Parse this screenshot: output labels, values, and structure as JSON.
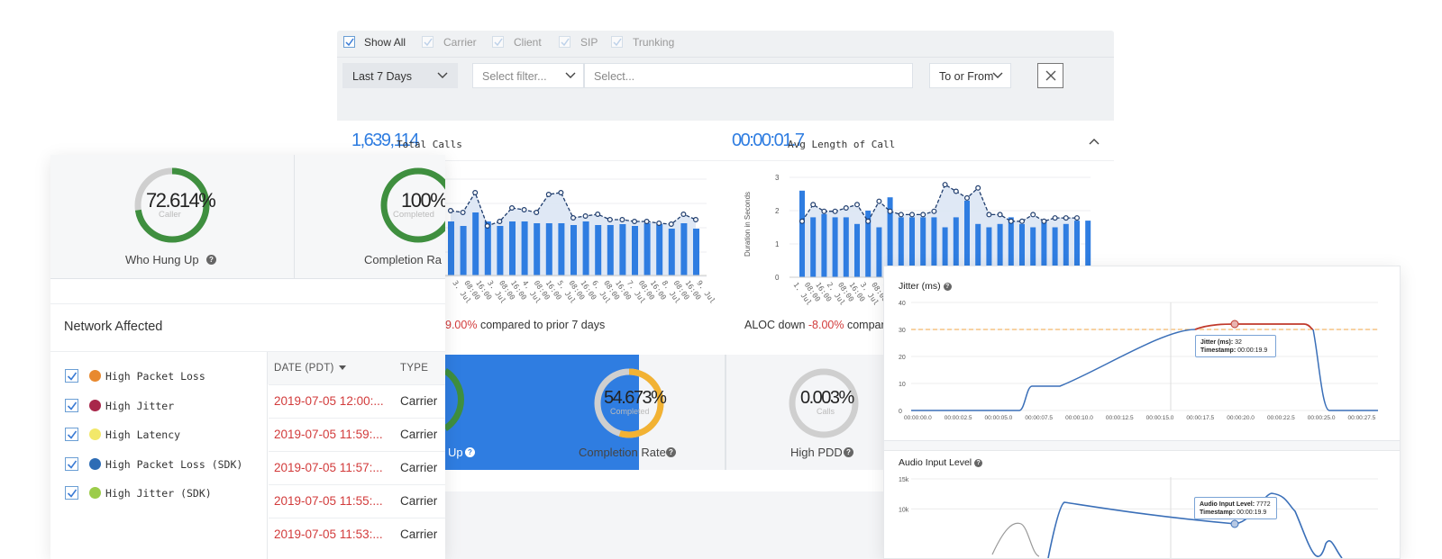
{
  "filters": {
    "show_all": "Show All",
    "carrier": "Carrier",
    "client": "Client",
    "sip": "SIP",
    "trunking": "Trunking"
  },
  "toolbar": {
    "date_range": "Last 7 Days",
    "filter_select_placeholder": "Select filter...",
    "filter_value_placeholder": "Select...",
    "direction": "To or From"
  },
  "summary": {
    "total_calls_value": "1,639,114",
    "total_calls_label": "Total Calls",
    "avg_length_value": "00:00:01.7",
    "avg_length_label": "Avg Length of Call",
    "calls_change_pct": "9.00%",
    "calls_change_text": "compared to prior 7 days",
    "aloc_prefix": "ALOC down",
    "aloc_change_pct": "-8.00%",
    "aloc_change_text": "compare"
  },
  "calls_chart": {
    "x_labels": [
      "3.\nJul",
      "08:00",
      "16:00",
      "3.\nJul",
      "08:00",
      "16:00",
      "4.\nJul",
      "08:00",
      "16:00",
      "5.\nJul",
      "08:00",
      "16:00",
      "6.\nJul",
      "08:00",
      "16:00",
      "7.\nJul",
      "08:00",
      "16:00",
      "8.\nJul",
      "08:00",
      "16:00",
      "9.\nJul"
    ]
  },
  "aloc_chart": {
    "ylabel": "Duration in Seconds",
    "y_ticks": [
      "3",
      "2",
      "1",
      "0"
    ],
    "x_labels": [
      "1.\nJul",
      "08:00",
      "16:00",
      "2.\nJul",
      "08:00",
      "16:00",
      "3.\nJul",
      "08:00",
      "16:00"
    ]
  },
  "kpis": {
    "who_hung_up_value": "72.614%",
    "who_hung_up_sub": "Caller",
    "who_hung_up_label": "Who Hung Up",
    "completion_value": "100%",
    "completion_sub": "Completed",
    "completion_label": "Completion Ra",
    "hung_up_label": "Up",
    "completion2_value": "54.673%",
    "completion2_sub": "Completed",
    "completion2_label": "Completion Rate",
    "pdd_value": "0.003%",
    "pdd_sub": "Calls",
    "pdd_label": "High PDD"
  },
  "network": {
    "title": "Network Affected",
    "legend": [
      {
        "label": "High Packet Loss",
        "color": "#e8892f"
      },
      {
        "label": "High Jitter",
        "color": "#a8274a"
      },
      {
        "label": "High Latency",
        "color": "#f2e86a"
      },
      {
        "label": "High Packet Loss (SDK)",
        "color": "#2d6cb5"
      },
      {
        "label": "High Jitter (SDK)",
        "color": "#9ccc4a"
      }
    ],
    "col_date": "DATE (PDT)",
    "col_type": "TYPE",
    "rows": [
      {
        "date": "2019-07-05 12:00:...",
        "type": "Carrier"
      },
      {
        "date": "2019-07-05 11:59:...",
        "type": "Carrier"
      },
      {
        "date": "2019-07-05 11:57:...",
        "type": "Carrier"
      },
      {
        "date": "2019-07-05 11:55:...",
        "type": "Carrier"
      },
      {
        "date": "2019-07-05 11:53:...",
        "type": "Carrier"
      }
    ]
  },
  "jitter": {
    "title": "Jitter (ms)",
    "y_ticks": [
      "40",
      "30",
      "20",
      "10",
      "0"
    ],
    "x_ticks": [
      "00:00:00.0",
      "00:00:02.5",
      "00:00:05.0",
      "00:00:07.5",
      "00:00:10.0",
      "00:00:12.5",
      "00:00:15.0",
      "00:00:17.5",
      "00:00:20.0",
      "00:00:22.5",
      "00:00:25.0",
      "00:00:27.5"
    ],
    "tooltip_k1": "Jitter (ms):",
    "tooltip_v1": "32",
    "tooltip_k2": "Timestamp:",
    "tooltip_v2": "00:00:19.9"
  },
  "audio": {
    "title": "Audio Input Level",
    "y_ticks": [
      "15k",
      "10k"
    ],
    "tooltip_k1": "Audio Input Level:",
    "tooltip_v1": "7772",
    "tooltip_k2": "Timestamp:",
    "tooltip_v2": "00:00:19.9"
  },
  "colors": {
    "accent_blue": "#2f7de1",
    "ring_green": "#3f8f3f",
    "ring_orange": "#f2b233",
    "ring_gray": "#cfcfcf",
    "negative_red": "#d23b3b",
    "jitter_red": "#c0392b",
    "line_blue": "#3a6fb8"
  }
}
